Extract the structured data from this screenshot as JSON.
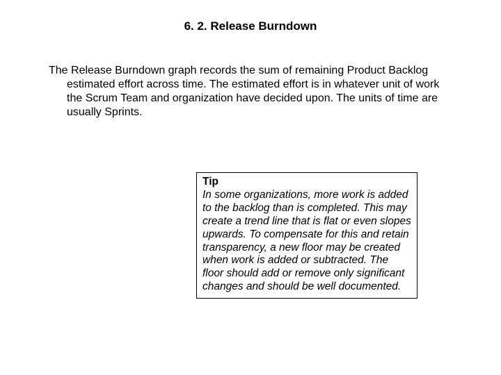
{
  "heading": "6. 2. Release Burndown",
  "paragraph": "The Release Burndown graph records the sum of remaining Product Backlog estimated effort across time. The estimated effort is in whatever unit of work the Scrum Team and organization have decided upon. The units of time are usually Sprints.",
  "tip": {
    "title": "Tip",
    "body": "In some organizations, more work is added to the backlog than is completed. This may create a trend line that is flat or even slopes upwards. To compensate for this and retain transparency, a new floor may be created when work is added or subtracted. The floor should add or remove only significant changes and should be well documented."
  }
}
